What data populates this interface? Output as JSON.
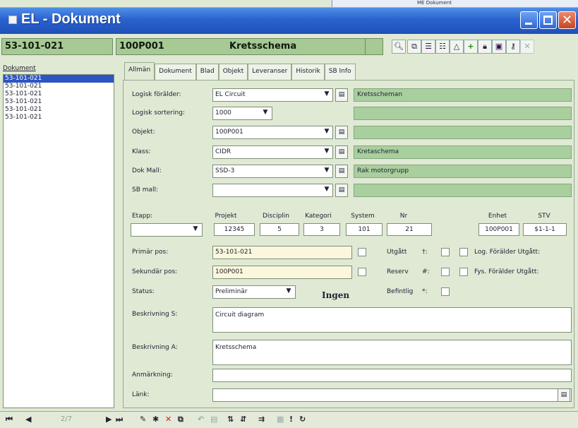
{
  "background_window": {
    "text": "ME Dokument"
  },
  "window": {
    "title": "EL - Dokument"
  },
  "header": {
    "doc_number": "53-101-021",
    "object_id": "100P001",
    "object_name": "Kretsschema"
  },
  "toolbar_icons": [
    "search-icon",
    "copy-icon",
    "indent-icon",
    "outdent-icon",
    "approve-icon",
    "add-icon",
    "lock-icon",
    "save-icon",
    "key-icon",
    "delete-icon"
  ],
  "list": {
    "label": "Dokument",
    "items": [
      "53-101-021",
      "53-101-021",
      "53-101-021",
      "53-101-021",
      "53-101-021",
      "53-101-021"
    ],
    "selected_index": 0
  },
  "tabs": [
    "Allmän",
    "Dokument",
    "Blad",
    "Objekt",
    "Leveranser",
    "Historik",
    "SB Info"
  ],
  "active_tab": "Allmän",
  "form": {
    "logisk_forelder": {
      "label": "Logisk förälder:",
      "value": "EL Circuit",
      "desc": "Kretsscheman"
    },
    "logisk_sortering": {
      "label": "Logisk sortering:",
      "value": "1000"
    },
    "objekt": {
      "label": "Objekt:",
      "value": "100P001"
    },
    "klass": {
      "label": "Klass:",
      "value": "CIDR",
      "desc": "Kretaschema"
    },
    "dok_mall": {
      "label": "Dok Mall:",
      "value": "SSD-3",
      "desc": "Rak motorgrupp"
    },
    "sb_mall": {
      "label": "SB mall:",
      "value": ""
    },
    "etapp": {
      "label": "Etapp:",
      "value": ""
    },
    "columns": {
      "projekt": {
        "label": "Projekt",
        "value": "12345"
      },
      "disciplin": {
        "label": "Disciplin",
        "value": "5"
      },
      "kategori": {
        "label": "Kategori",
        "value": "3"
      },
      "system": {
        "label": "System",
        "value": "101"
      },
      "nr": {
        "label": "Nr",
        "value": "21"
      },
      "enhet": {
        "label": "Enhet",
        "value": "100P001"
      },
      "stv": {
        "label": "STV",
        "value": "$1-1-1"
      }
    },
    "primar_pos": {
      "label": "Primär pos:",
      "value": "53-101-021"
    },
    "sekundar_pos": {
      "label": "Sekundär pos:",
      "value": "100P001"
    },
    "status": {
      "label": "Status:",
      "value": "Preliminär",
      "extra": "Ingen"
    },
    "utgatt": {
      "label": "Utgått",
      "sym": "†:"
    },
    "reserv": {
      "label": "Reserv",
      "sym": "#:"
    },
    "befintlig": {
      "label": "Befintlig",
      "sym": "*:"
    },
    "log_forelder_utgatt": "Log. Förälder Utgått:",
    "fys_forelder_utgatt": "Fys. Förälder Utgått:",
    "beskrivning_s": {
      "label": "Beskrivning S:",
      "value": "Circuit diagram"
    },
    "beskrivning_a": {
      "label": "Beskrivning A:",
      "value": "Kretsschema"
    },
    "anmarkning": {
      "label": "Anmärkning:",
      "value": ""
    },
    "lank": {
      "label": "Länk:",
      "value": ""
    }
  },
  "nav": {
    "position": "2/7"
  }
}
